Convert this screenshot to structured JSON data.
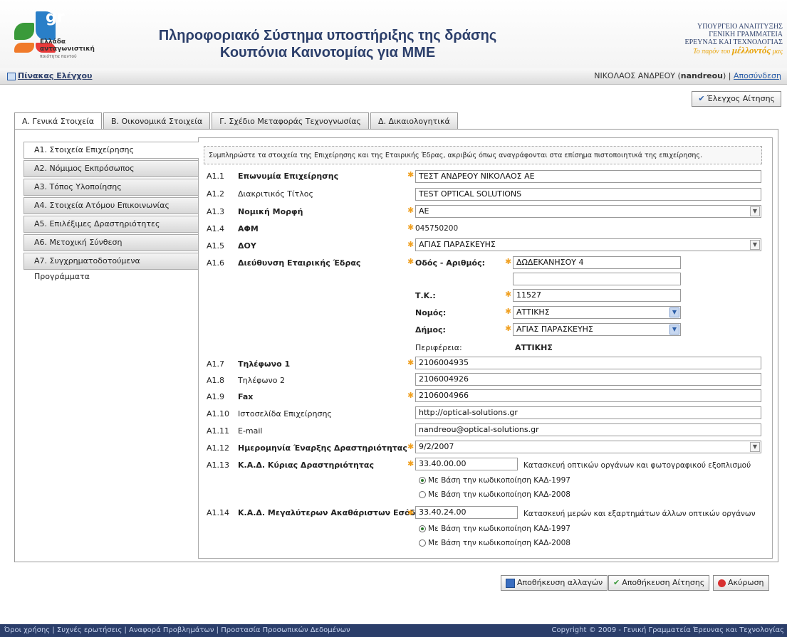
{
  "header": {
    "logo_text": "Ελλάδα",
    "logo_sub": "ανταγωνιστική",
    "logo_sub2": "ποιότητα παντού",
    "title_line1": "Πληροφοριακό Σύστημα υποστήριξης της δράσης",
    "title_line2": "Κουπόνια Καινοτομίας για ΜΜΕ",
    "ministry_line1": "ΥΠΟΥΡΓΕΙΟ ΑΝΑΠΤΥΞΗΣ",
    "ministry_line2": "ΓΕΝΙΚΗ ΓΡΑΜΜΑΤΕΙΑ",
    "ministry_line3": "ΕΡΕΥΝΑΣ ΚΑΙ ΤΕΧΝΟΛΟΓΙΑΣ",
    "slogan_a": "Το παρόν του",
    "slogan_b": "μέλλοντός",
    "slogan_c": "μας"
  },
  "navbar": {
    "dashboard": "Πίνακας Ελέγχου",
    "user_name": "ΝΙΚΟΛΑΟΣ ΑΝΔΡΕΟΥ",
    "user_login": "nandreou",
    "logout": "Αποσύνδεση"
  },
  "check_button": "Έλεγχος Αίτησης",
  "tabs": [
    {
      "label": "Α. Γενικά Στοιχεία"
    },
    {
      "label": "Β. Οικονομικά Στοιχεία"
    },
    {
      "label": "Γ. Σχέδιο Μεταφοράς Τεχνογνωσίας"
    },
    {
      "label": "Δ. Δικαιολογητικά"
    }
  ],
  "side_items": [
    {
      "label": "Α1. Στοιχεία Επιχείρησης"
    },
    {
      "label": "Α2. Νόμιμος Εκπρόσωπος"
    },
    {
      "label": "Α3. Τόπος Υλοποίησης"
    },
    {
      "label": "Α4. Στοιχεία Ατόμου Επικοινωνίας"
    },
    {
      "label": "Α5. Επιλέξιμες Δραστηριότητες"
    },
    {
      "label": "Α6. Μετοχική Σύνθεση"
    },
    {
      "label": "Α7. Συγχρηματοδοτούμενα Προγράμματα"
    }
  ],
  "intro": "Συμπληρώστε τα στοιχεία της Επιχείρησης και της Εταιρικής Έδρας, ακριβώς όπως αναγράφονται στα επίσημα πιστοποιητικά της επιχείρησης.",
  "fields": {
    "a1_1": {
      "code": "Α1.1",
      "label": "Επωνυμία Επιχείρησης",
      "value": "ΤΕΣΤ ΑΝΔΡΕΟΥ ΝΙΚΟΛΑΟΣ ΑΕ"
    },
    "a1_2": {
      "code": "Α1.2",
      "label": "Διακριτικός Τίτλος",
      "value": "TEST OPTICAL SOLUTIONS"
    },
    "a1_3": {
      "code": "Α1.3",
      "label": "Νομική Μορφή",
      "value": "ΑΕ"
    },
    "a1_4": {
      "code": "Α1.4",
      "label": "ΑΦΜ",
      "value": "045750200"
    },
    "a1_5": {
      "code": "Α1.5",
      "label": "ΔΟΥ",
      "value": "ΑΓΙΑΣ ΠΑΡΑΣΚΕΥΗΣ"
    },
    "a1_6": {
      "code": "Α1.6",
      "label": "Διεύθυνση Εταιρικής Έδρας"
    },
    "street_label": "Οδός - Αριθμός:",
    "street_value": "ΔΩΔΕΚΑΝΗΣΟΥ 4",
    "street2_value": "",
    "tk_label": "Τ.Κ.:",
    "tk_value": "11527",
    "nomos_label": "Νομός:",
    "nomos_value": "ΑΤΤΙΚΗΣ",
    "dimos_label": "Δήμος:",
    "dimos_value": "ΑΓΙΑΣ ΠΑΡΑΣΚΕΥΗΣ",
    "perifereia_label": "Περιφέρεια:",
    "perifereia_value": "ΑΤΤΙΚΗΣ",
    "a1_7": {
      "code": "Α1.7",
      "label": "Τηλέφωνο 1",
      "value": "2106004935"
    },
    "a1_8": {
      "code": "Α1.8",
      "label": "Τηλέφωνο 2",
      "value": "2106004926"
    },
    "a1_9": {
      "code": "Α1.9",
      "label": "Fax",
      "value": "2106004966"
    },
    "a1_10": {
      "code": "Α1.10",
      "label": "Ιστοσελίδα Επιχείρησης",
      "value": "http://optical-solutions.gr"
    },
    "a1_11": {
      "code": "Α1.11",
      "label": "E-mail",
      "value": "nandreou@optical-solutions.gr"
    },
    "a1_12": {
      "code": "Α1.12",
      "label": "Ημερομηνία Έναρξης Δραστηριότητας",
      "value": "9/2/2007"
    },
    "a1_13": {
      "code": "Α1.13",
      "label": "Κ.Α.Δ. Κύριας Δραστηριότητας",
      "value": "33.40.00.00",
      "desc": "Κατασκευή οπτικών οργάνων και φωτογραφικού εξοπλισμού"
    },
    "a1_14": {
      "code": "Α1.14",
      "label": "Κ.Α.Δ. Μεγαλύτερων Ακαθάριστων Εσόδων",
      "value": "33.40.24.00",
      "desc": "Κατασκευή μερών και εξαρτημάτων άλλων οπτικών οργάνων"
    },
    "radio_1997": "Με Βάση την κωδικοποίηση ΚΑΔ-1997",
    "radio_2008": "Με Βάση την κωδικοποίηση ΚΑΔ-2008"
  },
  "buttons": {
    "save_changes": "Αποθήκευση αλλαγών",
    "save_application": "Αποθήκευση Αίτησης",
    "cancel": "Ακύρωση"
  },
  "footer": {
    "terms": "Όροι χρήσης",
    "faq": "Συχνές ερωτήσεις",
    "report": "Αναφορά Προβλημάτων",
    "privacy": "Προστασία Προσωπικών Δεδομένων",
    "copyright": "Copyright © 2009 - Γενική Γραμματεία Έρευνας και Τεχνολογίας"
  },
  "colors": {
    "brand": "#2b3e6a",
    "required": "#f0a020"
  }
}
